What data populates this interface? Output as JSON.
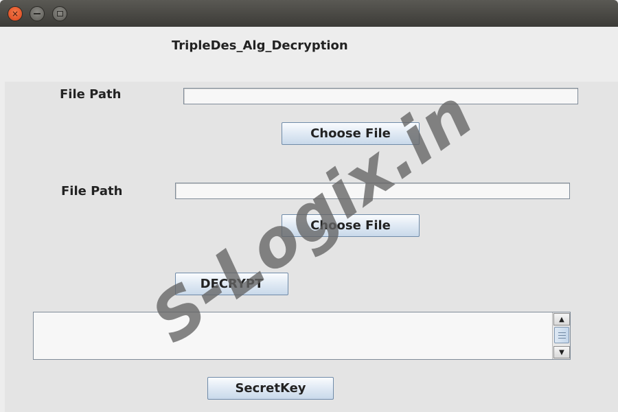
{
  "window": {
    "controls": {
      "close_icon": "×",
      "minimize": "minimize-icon",
      "maximize": "maximize-icon"
    }
  },
  "heading": "TripleDes_Alg_Decryption",
  "file1": {
    "label": "File Path",
    "value": "",
    "button": "Choose File"
  },
  "file2": {
    "label": "File Path",
    "value": "",
    "button": "Choose File"
  },
  "decrypt_button": "DECRYPT",
  "output": {
    "value": "",
    "scroll_up_icon": "▲",
    "scroll_down_icon": "▼"
  },
  "secretkey_button": "SecretKey",
  "watermark": "S-Logix.in"
}
